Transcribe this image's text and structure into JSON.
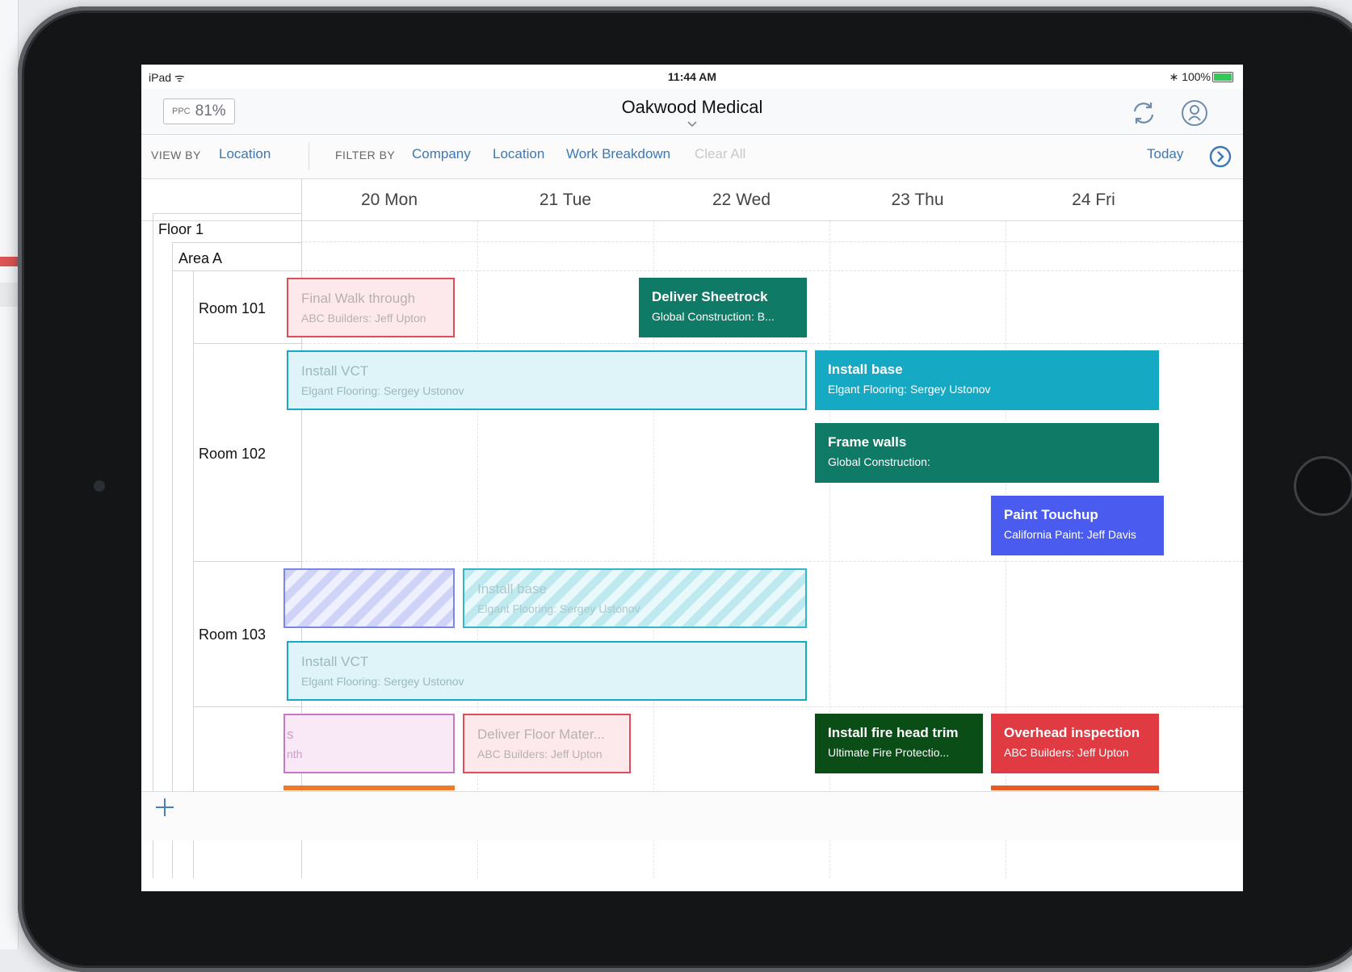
{
  "status_bar": {
    "device": "iPad",
    "time": "11:44 AM",
    "battery": "100%"
  },
  "header": {
    "ppc_label": "PPC",
    "ppc_value": "81%",
    "title": "Oakwood Medical"
  },
  "filter_bar": {
    "view_by_label": "VIEW BY",
    "view_by_value": "Location",
    "filter_by_label": "FILTER BY",
    "filters": [
      "Company",
      "Location",
      "Work Breakdown"
    ],
    "clear_all": "Clear All",
    "today": "Today"
  },
  "days": [
    "20 Mon",
    "21 Tue",
    "22 Wed",
    "23 Thu",
    "24 Fri"
  ],
  "locations": {
    "floor": "Floor 1",
    "area": "Area A",
    "rooms": [
      "Room 101",
      "Room 102",
      "Room 103"
    ]
  },
  "tasks": {
    "final_walk": {
      "title": "Final Walk through",
      "sub": "ABC Builders: Jeff Upton"
    },
    "deliver_sheetrock": {
      "title": "Deliver Sheetrock",
      "sub": "Global Construction: B..."
    },
    "install_vct_102": {
      "title": "Install VCT",
      "sub": "Elgant Flooring: Sergey Ustonov"
    },
    "install_base_102": {
      "title": "Install base",
      "sub": "Elgant Flooring: Sergey Ustonov"
    },
    "frame_walls": {
      "title": "Frame walls",
      "sub": "Global Construction:"
    },
    "paint_touchup": {
      "title": "Paint Touchup",
      "sub": "California Paint: Jeff Davis"
    },
    "install_base_103": {
      "title": "Install base",
      "sub": "Elgant Flooring: Sergey Ustonov"
    },
    "install_vct_103": {
      "title": "Install VCT",
      "sub": "Elgant Flooring: Sergey Ustonov"
    },
    "pink_partial": {
      "title": "s",
      "sub": "nth"
    },
    "deliver_floor": {
      "title": "Deliver Floor Mater...",
      "sub": "ABC Builders: Jeff Upton"
    },
    "fire_head": {
      "title": "Install fire head trim",
      "sub": "Ultimate Fire Protectio..."
    },
    "overhead": {
      "title": "Overhead inspection",
      "sub": "ABC Builders: Jeff Upton"
    }
  },
  "colors": {
    "teal_dark": "#0f7a66",
    "cyan": "#15a9c4",
    "indigo": "#4a5cf0",
    "green_dark": "#0b4d16",
    "red": "#e03a43",
    "orange": "#f07a2a"
  },
  "icons": [
    "wifi-icon",
    "bluetooth-icon",
    "battery-icon",
    "chevron-down-icon",
    "sync-icon",
    "user-icon",
    "today-icon",
    "plus-icon"
  ]
}
